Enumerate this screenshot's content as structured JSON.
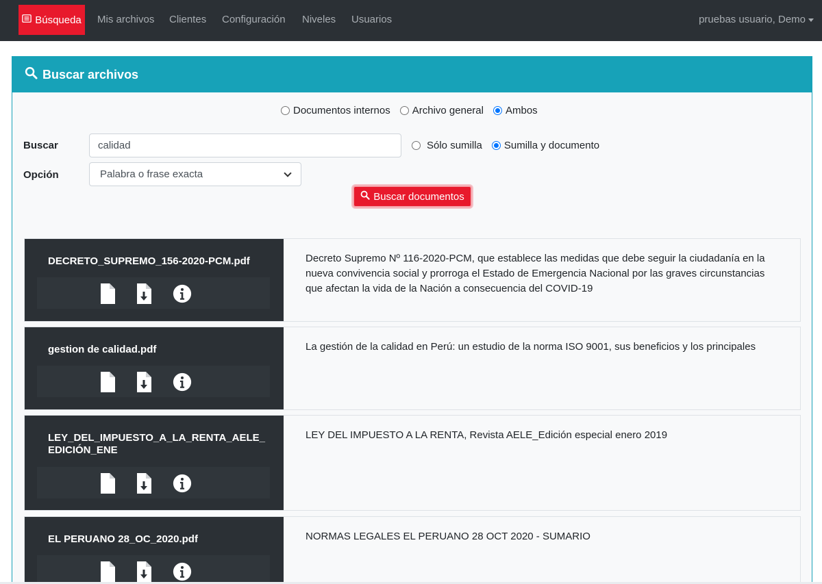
{
  "navbar": {
    "brand_label": "Búsqueda",
    "links": [
      "Mis archivos",
      "Clientes",
      "Configuración",
      "Niveles",
      "Usuarios"
    ],
    "user_label": "pruebas usuario, Demo"
  },
  "panel": {
    "title": "Buscar archivos",
    "source_options": [
      {
        "label": "Documentos internos",
        "checked": false
      },
      {
        "label": "Archivo general",
        "checked": false
      },
      {
        "label": "Ambos",
        "checked": true
      }
    ],
    "buscar_label": "Buscar",
    "search_value": "calidad",
    "scope_options": [
      {
        "label": "Sólo sumilla",
        "checked": false
      },
      {
        "label": "Sumilla y documento",
        "checked": true
      }
    ],
    "opcion_label": "Opción",
    "opcion_value": "Palabra o frase exacta",
    "search_button": "Buscar documentos"
  },
  "results": [
    {
      "filename": "DECRETO_SUPREMO_156-2020-PCM.pdf",
      "description": "Decreto Supremo Nº 116-2020-PCM, que establece las medidas que debe seguir la ciudadanía en la nueva convivencia social y prorroga el Estado de Emergencia Nacional por las graves circunstancias que afectan la vida de la Nación a consecuencia del COVID-19"
    },
    {
      "filename": "gestion de calidad.pdf",
      "description": "La gestión de la calidad en Perú: un estudio de la norma ISO 9001, sus beneficios y los principales"
    },
    {
      "filename": "LEY_DEL_IMPUESTO_A_LA_RENTA_AELE_EDICIÓN_ENE",
      "description": "LEY DEL IMPUESTO A LA RENTA, Revista AELE_Edición especial enero 2019"
    },
    {
      "filename": "EL PERUANO 28_OC_2020.pdf",
      "description": "NORMAS LEGALES EL PERUANO 28 OCT 2020 - SUMARIO"
    }
  ],
  "colors": {
    "navbar": "#2b3035",
    "brand_red": "#e8192c",
    "panel_teal": "#17a2b8",
    "radio_blue": "#0075ff"
  },
  "icons": [
    "list-icon",
    "search-icon",
    "file-icon",
    "file-download-icon",
    "info-circle-icon"
  ]
}
